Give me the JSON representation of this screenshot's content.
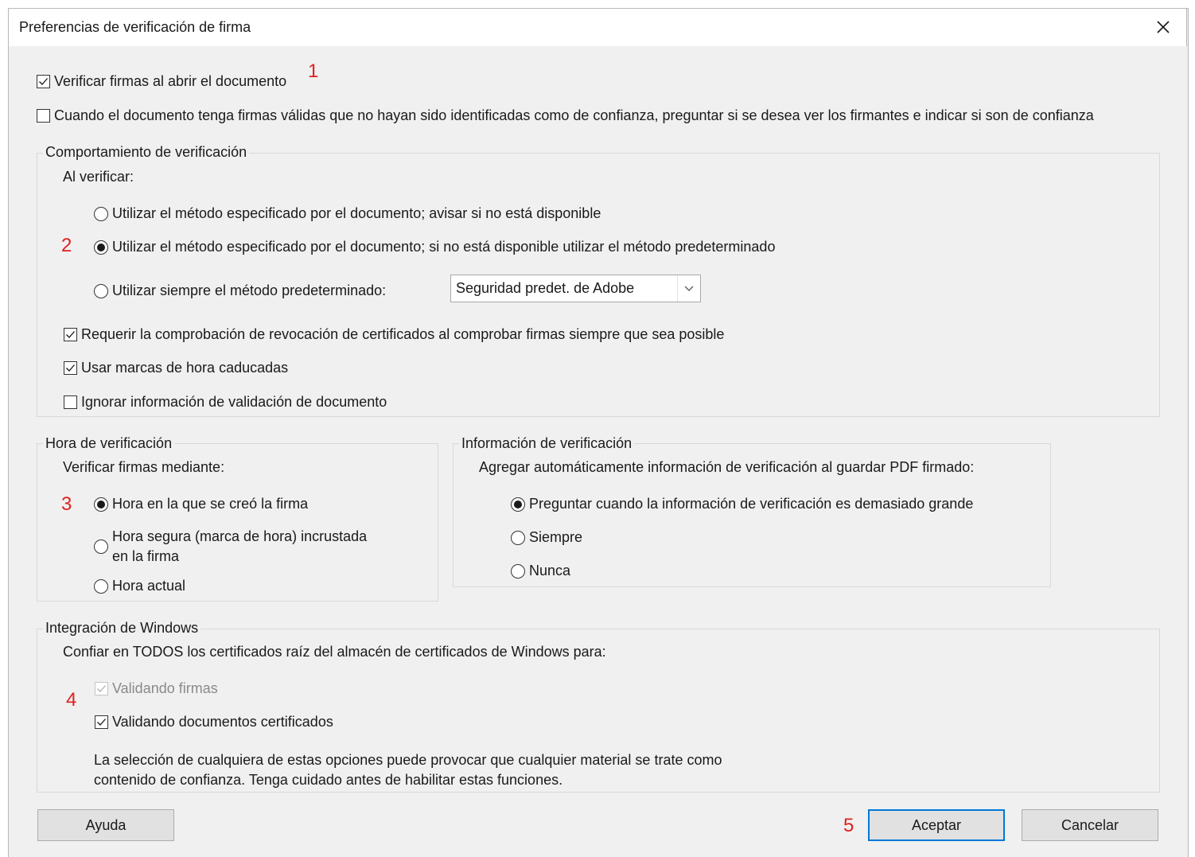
{
  "window": {
    "title": "Preferencias de verificación de firma",
    "close_icon": "close-icon"
  },
  "top_options": {
    "verify_on_open": {
      "label": "Verificar firmas al abrir el documento",
      "checked": true
    },
    "ask_trust": {
      "label": "Cuando el documento tenga firmas válidas que no hayan sido identificadas como de confianza, preguntar si se desea ver los firmantes e indicar si son de confianza",
      "checked": false
    }
  },
  "behavior": {
    "legend": "Comportamiento de verificación",
    "subheading": "Al verificar:",
    "radios": [
      {
        "label": "Utilizar el método especificado por el documento; avisar si no está disponible",
        "selected": false
      },
      {
        "label": "Utilizar el método especificado por el documento; si no está disponible utilizar el método predeterminado",
        "selected": true
      },
      {
        "label": "Utilizar siempre el método predeterminado:",
        "selected": false
      }
    ],
    "default_method_select": {
      "value": "Seguridad predet. de Adobe"
    },
    "checks": [
      {
        "label": "Requerir la comprobación de revocación de certificados al comprobar firmas siempre que sea posible",
        "checked": true
      },
      {
        "label": "Usar marcas de hora caducadas",
        "checked": true
      },
      {
        "label": "Ignorar información de validación de documento",
        "checked": false
      }
    ]
  },
  "verification_time": {
    "legend": "Hora de verificación",
    "subheading": "Verificar firmas mediante:",
    "radios": [
      {
        "label": "Hora en la que se creó la firma",
        "selected": true
      },
      {
        "label_line1": "Hora segura (marca de hora) incrustada",
        "label_line2": "en la firma",
        "selected": false
      },
      {
        "label": "Hora actual",
        "selected": false
      }
    ]
  },
  "verification_info": {
    "legend": "Información de verificación",
    "subheading": "Agregar automáticamente información de verificación al guardar PDF firmado:",
    "radios": [
      {
        "label": "Preguntar cuando la información de verificación es demasiado grande",
        "selected": true
      },
      {
        "label": "Siempre",
        "selected": false
      },
      {
        "label": "Nunca",
        "selected": false
      }
    ]
  },
  "windows_integration": {
    "legend": "Integración de Windows",
    "subheading": "Confiar en TODOS los certificados raíz del almacén de certificados de Windows para:",
    "checks": [
      {
        "label": "Validando firmas",
        "checked": true,
        "disabled": true
      },
      {
        "label": "Validando documentos certificados",
        "checked": true,
        "disabled": false
      }
    ],
    "note_line1": "La selección de cualquiera de estas opciones puede provocar que cualquier material se trate como",
    "note_line2": "contenido de confianza. Tenga cuidado antes de habilitar estas funciones."
  },
  "buttons": {
    "help": "Ayuda",
    "ok": "Aceptar",
    "cancel": "Cancelar"
  },
  "annotations": [
    "1",
    "2",
    "3",
    "4",
    "5"
  ],
  "colors": {
    "annotation": "#e02020",
    "focus_border": "#0078d7",
    "dialog_bg": "#f0f0f0"
  }
}
